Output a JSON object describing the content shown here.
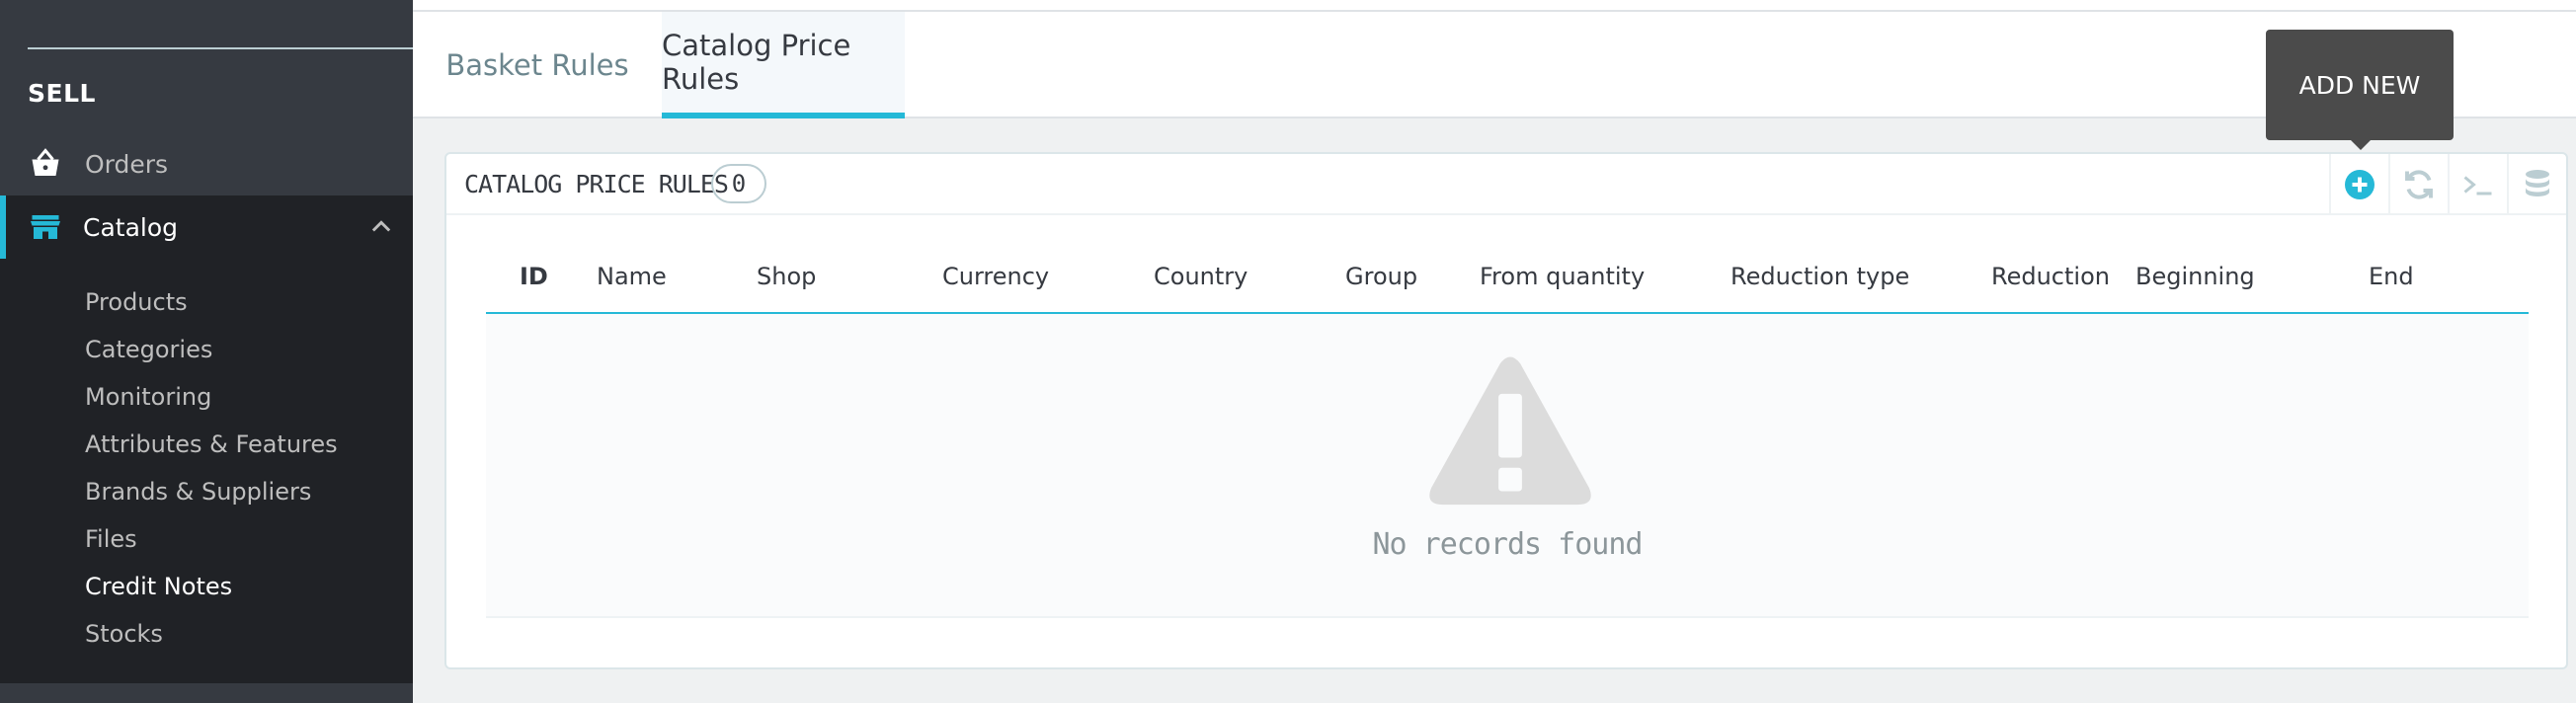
{
  "sidebar": {
    "section_title": "SELL",
    "items": [
      {
        "label": "Orders",
        "icon": "basket-icon"
      },
      {
        "label": "Catalog",
        "icon": "store-icon",
        "active": true
      }
    ],
    "catalog_submenu": [
      "Products",
      "Categories",
      "Monitoring",
      "Attributes & Features",
      "Brands & Suppliers",
      "Files",
      "Credit Notes",
      "Stocks"
    ],
    "active_submenu": "Credit Notes"
  },
  "tabs": [
    {
      "label": "Basket Rules"
    },
    {
      "label": "Catalog Price Rules",
      "active": true
    }
  ],
  "panel": {
    "title": "CATALOG PRICE RULES",
    "count": "0",
    "tooltip": "ADD NEW",
    "columns": [
      "ID",
      "Name",
      "Shop",
      "Currency",
      "Country",
      "Group",
      "From quantity",
      "Reduction type",
      "Reduction",
      "Beginning",
      "End"
    ],
    "empty_message": "No records found"
  },
  "colors": {
    "sidebar_bg": "#363a41",
    "submenu_bg": "#202226",
    "accent": "#25b9d7",
    "page_bg": "#eff1f2"
  }
}
